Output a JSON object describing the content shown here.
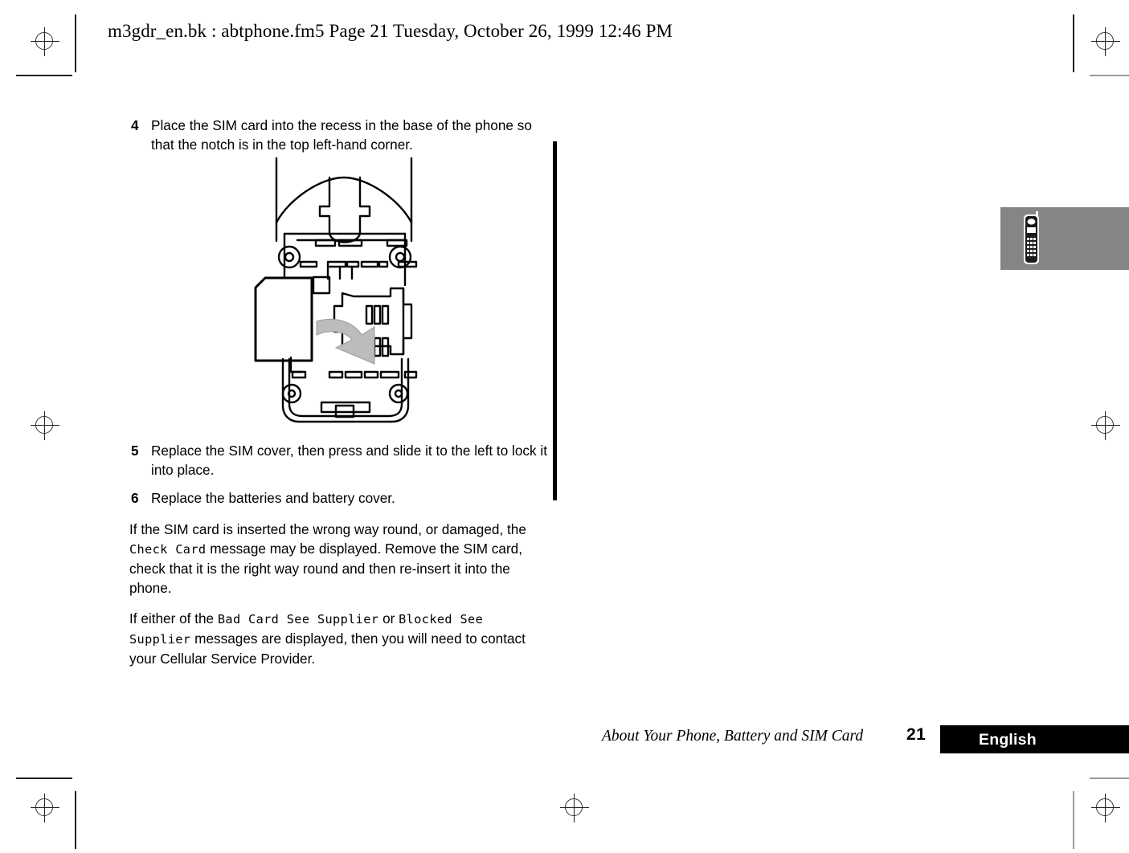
{
  "page": {
    "header_line": "m3gdr_en.bk : abtphone.fm5  Page 21  Tuesday, October 26, 1999  12:46 PM",
    "page_number": "21",
    "footer_title": "About Your Phone, Battery and SIM Card",
    "language_tab": "English"
  },
  "steps": [
    {
      "number": "4",
      "text": "Place the SIM card into the recess in the base of the phone so that the notch is in the top left-hand corner."
    },
    {
      "number": "5",
      "text": "Replace the SIM cover, then press and slide it to the left to lock it into place."
    },
    {
      "number": "6",
      "text": "Replace the batteries and battery cover."
    }
  ],
  "paragraphs": {
    "p1": {
      "seg1": "If the SIM card is inserted the wrong way round, or damaged, the ",
      "lcd1": "Check Card",
      "seg2": " message may be displayed. Remove the SIM card, check that it is the right way round and then re-insert it into the phone."
    },
    "p2": {
      "seg1": "If either of the ",
      "lcd1": "Bad Card See Supplier",
      "seg2": " or ",
      "lcd2": "Blocked See Supplier",
      "seg3": " messages are displayed, then you will need to contact your Cellular Service Provider."
    }
  },
  "figure": {
    "caption_alt": "Line drawing of phone base with SIM card being inserted, gray arrow pointing into recess",
    "arrow_color": "#bcbcbc",
    "line_color": "#000000"
  },
  "side_tab": {
    "icon": "mobile-phone-icon",
    "background_color": "#858585"
  },
  "colors": {
    "text": "#000000",
    "page_background": "#ffffff",
    "tab_black": "#000000",
    "tab_gray": "#858585",
    "change_bar": "#000000"
  }
}
